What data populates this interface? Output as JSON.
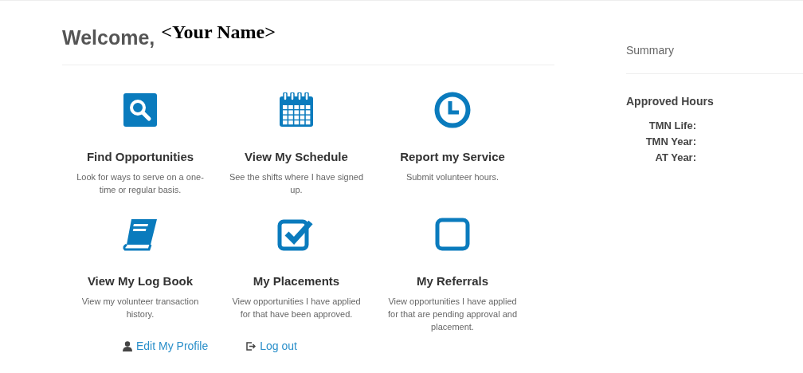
{
  "heading": {
    "greeting": "Welcome,",
    "name": "<Your Name>"
  },
  "tiles": [
    {
      "kind": "search",
      "title": "Find Opportunities",
      "description": "Look for ways to serve on a one-time or regular basis."
    },
    {
      "kind": "calendar",
      "title": "View My Schedule",
      "description": "See the shifts where I have signed up."
    },
    {
      "kind": "clock",
      "title": "Report my Service",
      "description": "Submit volunteer hours."
    },
    {
      "kind": "book",
      "title": "View My Log Book",
      "description": "View my volunteer transaction history."
    },
    {
      "kind": "checked",
      "title": "My Placements",
      "description": "View opportunities I have applied for that have been approved."
    },
    {
      "kind": "square",
      "title": "My Referrals",
      "description": "View opportunities I have applied for that are pending approval and placement."
    }
  ],
  "links": [
    {
      "kind": "user",
      "label": "Edit My Profile"
    },
    {
      "kind": "logout",
      "label": "Log out"
    }
  ],
  "summary": {
    "title": "Summary",
    "section": "Approved Hours",
    "rows": [
      "TMN Life:",
      "TMN Year:",
      "AT Year:"
    ]
  }
}
